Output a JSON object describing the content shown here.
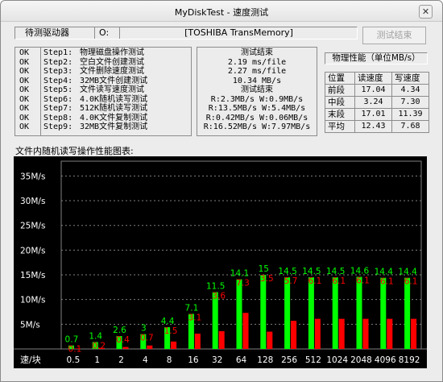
{
  "window": {
    "title": "MyDiskTest - 速度测试",
    "close_glyph": "✕"
  },
  "drive": {
    "label": "待测驱动器",
    "letter": "O:",
    "name": "[TOSHIBA TransMemory]"
  },
  "finish_button": "测试结束",
  "steps": [
    {
      "status": "OK",
      "step": "Step1:",
      "desc": "物理磁盘操作测试"
    },
    {
      "status": "OK",
      "step": "Step2:",
      "desc": "空白文件创建测试"
    },
    {
      "status": "OK",
      "step": "Step3:",
      "desc": "文件删除速度测试"
    },
    {
      "status": "OK",
      "step": "Step4:",
      "desc": "32MB文件创建测试"
    },
    {
      "status": "OK",
      "step": "Step5:",
      "desc": "文件读写速度测试"
    },
    {
      "status": "OK",
      "step": "Step6:",
      "desc": "4.0K随机读写测试"
    },
    {
      "status": "OK",
      "step": "Step7:",
      "desc": "512K随机读写测试"
    },
    {
      "status": "OK",
      "step": "Step8:",
      "desc": "4.0K文件复制测试"
    },
    {
      "status": "OK",
      "step": "Step9:",
      "desc": "32MB文件复制测试"
    }
  ],
  "results": [
    "测试结束",
    "2.19 ms/file",
    "2.27 ms/file",
    "10.34 MB/s",
    "测试结束",
    "R:2.3MB/s W:0.9MB/s",
    "R:13.5MB/s W:5.4MB/s",
    "R:0.42MB/s W:0.06MB/s",
    "R:16.52MB/s W:7.97MB/s"
  ],
  "perf": {
    "title": "物理性能（单位MB/s）",
    "headers": [
      "位置",
      "读速度",
      "写速度"
    ],
    "rows": [
      {
        "pos": "前段",
        "read": "17.04",
        "write": "4.34"
      },
      {
        "pos": "中段",
        "read": "3.24",
        "write": "7.30"
      },
      {
        "pos": "末段",
        "read": "17.01",
        "write": "11.39"
      },
      {
        "pos": "平均",
        "read": "12.43",
        "write": "7.68"
      }
    ]
  },
  "chart_label": "文件内随机读写操作性能图表:",
  "chart_data": {
    "type": "bar",
    "xlabel": "速/块",
    "categories": [
      "0.5",
      "1",
      "2",
      "4",
      "8",
      "16",
      "32",
      "64",
      "128",
      "256",
      "512",
      "1024",
      "2048",
      "4096",
      "8192"
    ],
    "series": [
      {
        "values": [
          0.7,
          1.4,
          2.6,
          3.0,
          4.4,
          7.1,
          11.5,
          14.1,
          15.0,
          14.5,
          14.5,
          14.5,
          14.6,
          14.4,
          14.4
        ],
        "color": "#00ff00"
      },
      {
        "values": [
          0.1,
          0.2,
          0.4,
          0.7,
          1.5,
          3.1,
          3.6,
          7.3,
          3.5,
          5.7,
          6.1,
          6.1,
          6.1,
          6.1,
          6.1
        ],
        "color": "#ff0000"
      }
    ],
    "ylim": [
      0,
      38
    ],
    "yticks": [
      5,
      10,
      15,
      20,
      25,
      30,
      35
    ],
    "ytick_labels": [
      "5M/s",
      "10M/s",
      "15M/s",
      "20M/s",
      "25M/s",
      "30M/s",
      "35M/s"
    ],
    "grid": true
  }
}
